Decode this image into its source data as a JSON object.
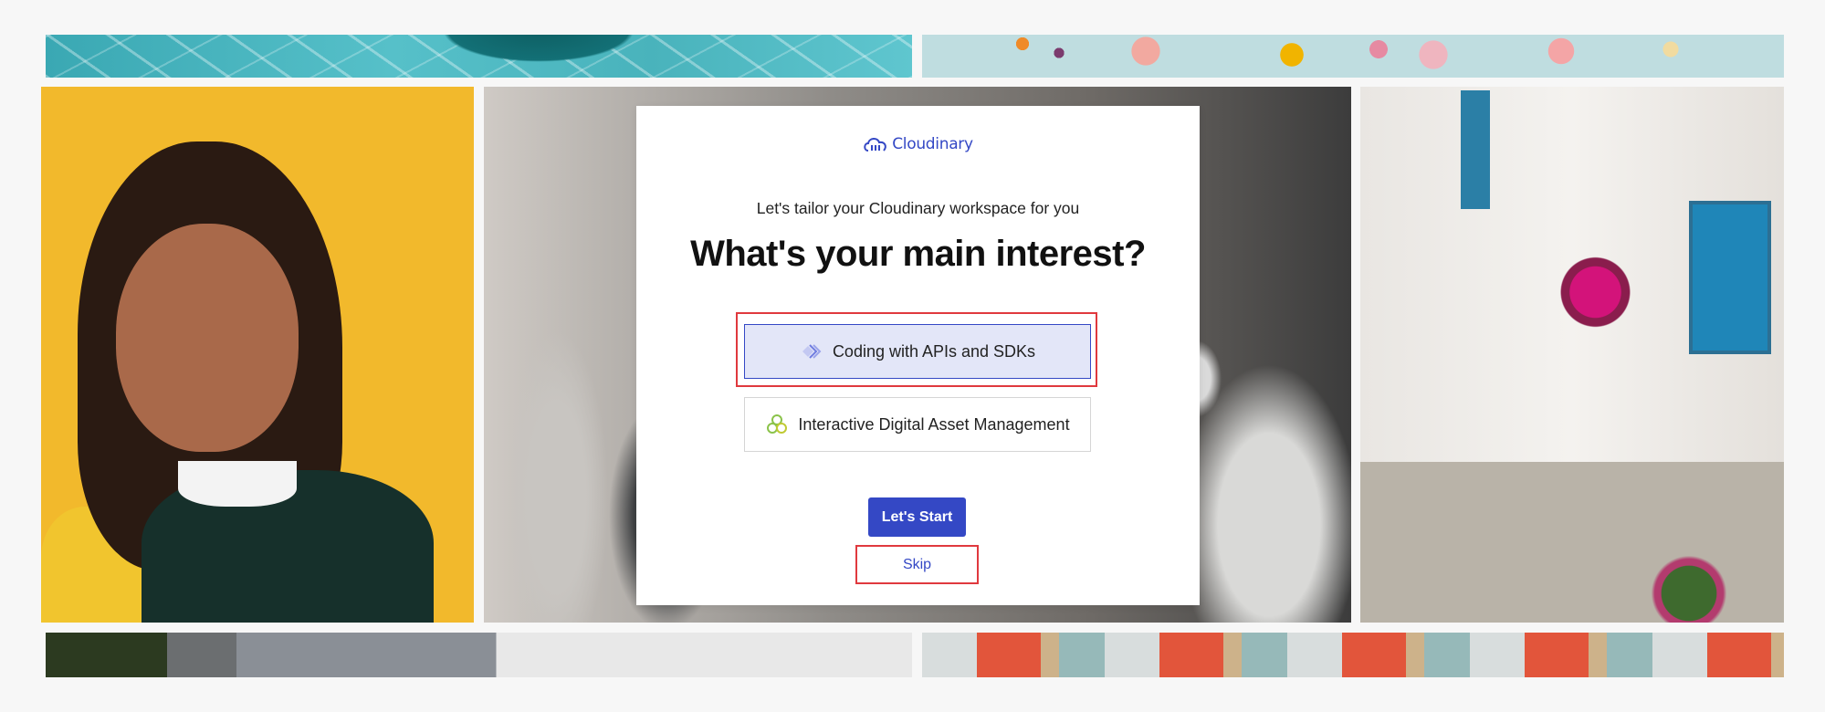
{
  "brand": {
    "name": "Cloudinary",
    "accent_color": "#3448c5",
    "highlight_color": "#e0393e"
  },
  "modal": {
    "subtitle": "Let's tailor your Cloudinary workspace for you",
    "title": "What's your main interest?",
    "options": [
      {
        "label": "Coding with APIs and SDKs",
        "icon": "code-chevron-icon",
        "selected": true
      },
      {
        "label": "Interactive Digital Asset Management",
        "icon": "asset-cubes-icon",
        "selected": false
      }
    ],
    "primary_button": "Let's Start",
    "skip_link": "Skip"
  },
  "background_tiles": [
    {
      "name": "tile-pool",
      "subject": "pool water"
    },
    {
      "name": "tile-flowers",
      "subject": "dried flowers"
    },
    {
      "name": "tile-portrait",
      "subject": "smiling woman portrait"
    },
    {
      "name": "tile-crowd",
      "subject": "blurred crowd"
    },
    {
      "name": "tile-greek",
      "subject": "white greek alley with blue door"
    },
    {
      "name": "tile-palm",
      "subject": "palm and building"
    },
    {
      "name": "tile-balcony",
      "subject": "colorful balconies"
    }
  ]
}
